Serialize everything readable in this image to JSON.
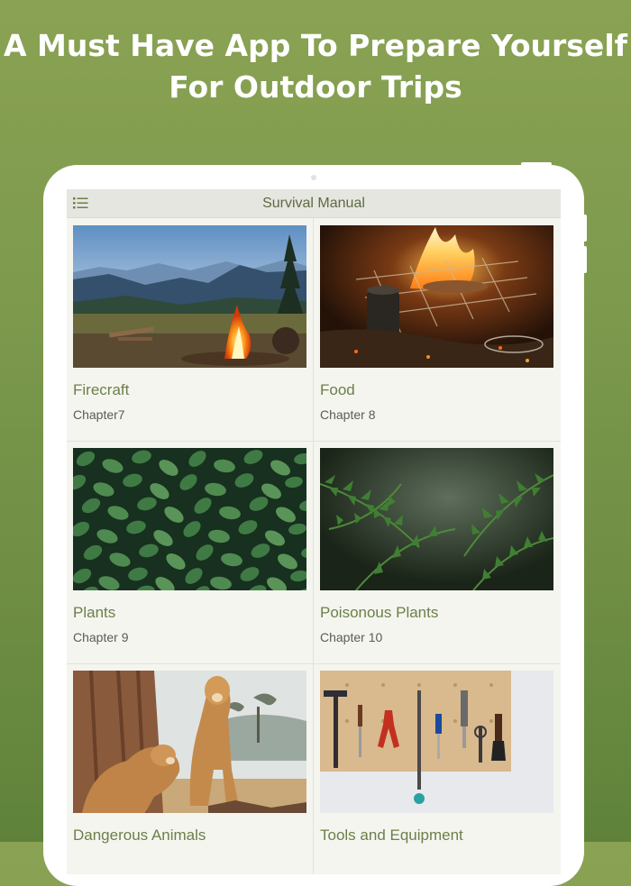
{
  "headline": {
    "line1": "A Must Have App To Prepare Yourself",
    "line2": "For Outdoor Trips"
  },
  "app": {
    "title": "Survival Manual",
    "menu_icon": "list-menu-icon"
  },
  "chapters": [
    {
      "title": "Firecraft",
      "subtitle": "Chapter7",
      "image": "campfire-mountains-photo"
    },
    {
      "title": "Food",
      "subtitle": "Chapter 8",
      "image": "campfire-cooking-photo"
    },
    {
      "title": "Plants",
      "subtitle": "Chapter 9",
      "image": "green-leaves-photo"
    },
    {
      "title": "Poisonous Plants",
      "subtitle": "Chapter 10",
      "image": "ferns-photo"
    },
    {
      "title": "Dangerous Animals",
      "subtitle": "",
      "image": "lionesses-photo"
    },
    {
      "title": "Tools and Equipment",
      "subtitle": "",
      "image": "tools-pegboard-photo"
    }
  ],
  "colors": {
    "background_top": "#8aa253",
    "background_bottom": "#5f823a",
    "accent_green": "#6b8048",
    "screen_bg": "#f5f5f0"
  }
}
